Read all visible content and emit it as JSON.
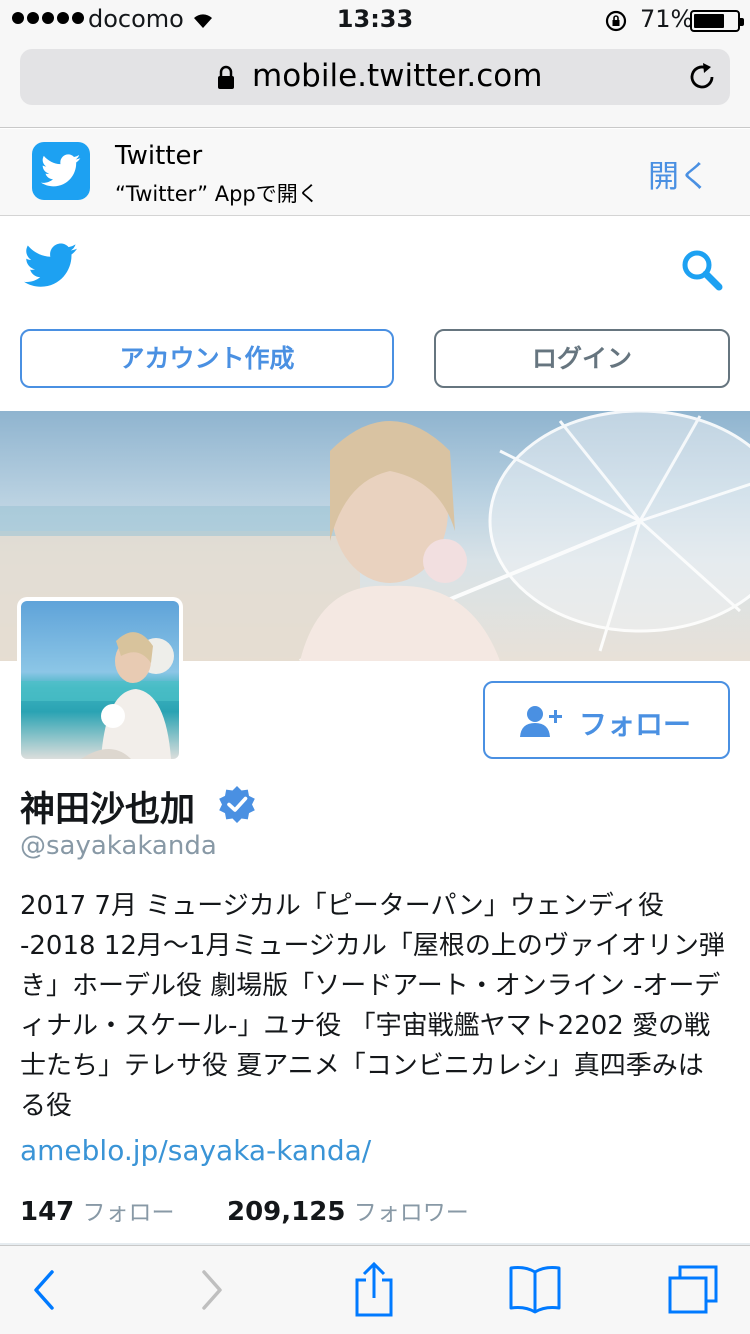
{
  "status_bar": {
    "carrier": "docomo",
    "time": "13:33",
    "battery_percent": "71%",
    "battery_level": 0.71,
    "icons": [
      "signal-dots",
      "wifi-icon",
      "rotation-lock-icon",
      "battery-icon"
    ]
  },
  "browser": {
    "url": "mobile.twitter.com",
    "icons": [
      "lock-icon",
      "reload-icon"
    ]
  },
  "app_banner": {
    "app_name": "Twitter",
    "subtitle": "“Twitter” Appで開く",
    "open_label": "開く"
  },
  "header": {
    "icons": [
      "twitter-bird-logo",
      "search-icon"
    ],
    "signup_label": "アカウント作成",
    "login_label": "ログイン"
  },
  "profile": {
    "name": "神田沙也加",
    "handle": "@sayakakanda",
    "follow_label": "フォロー",
    "bio": "2017 7月 ミュージカル「ピーターパン」ウェンディ役 -2018 12月〜1月ミュージカル「屋根の上のヴァイオリン弾き」ホーデル役 劇場版「ソードアート・オンライン -オーディナル・スケール-」ユナ役 「宇宙戦艦ヤマト2202 愛の戦士たち」テレサ役 夏アニメ「コンビニカレシ」真四季みはる役",
    "link": "ameblo.jp/sayaka-kanda/",
    "following_count": "147",
    "following_label": "フォロー",
    "followers_count": "209,125",
    "followers_label": "フォロワー"
  },
  "toolbar": {
    "icons": [
      "back-icon",
      "forward-icon",
      "share-icon",
      "bookmarks-icon",
      "tabs-icon"
    ]
  },
  "colors": {
    "twitter_blue": "#1da1f2",
    "link_blue": "#4a90e2",
    "text_gray": "#8899a6",
    "ios_blue": "#007aff"
  }
}
